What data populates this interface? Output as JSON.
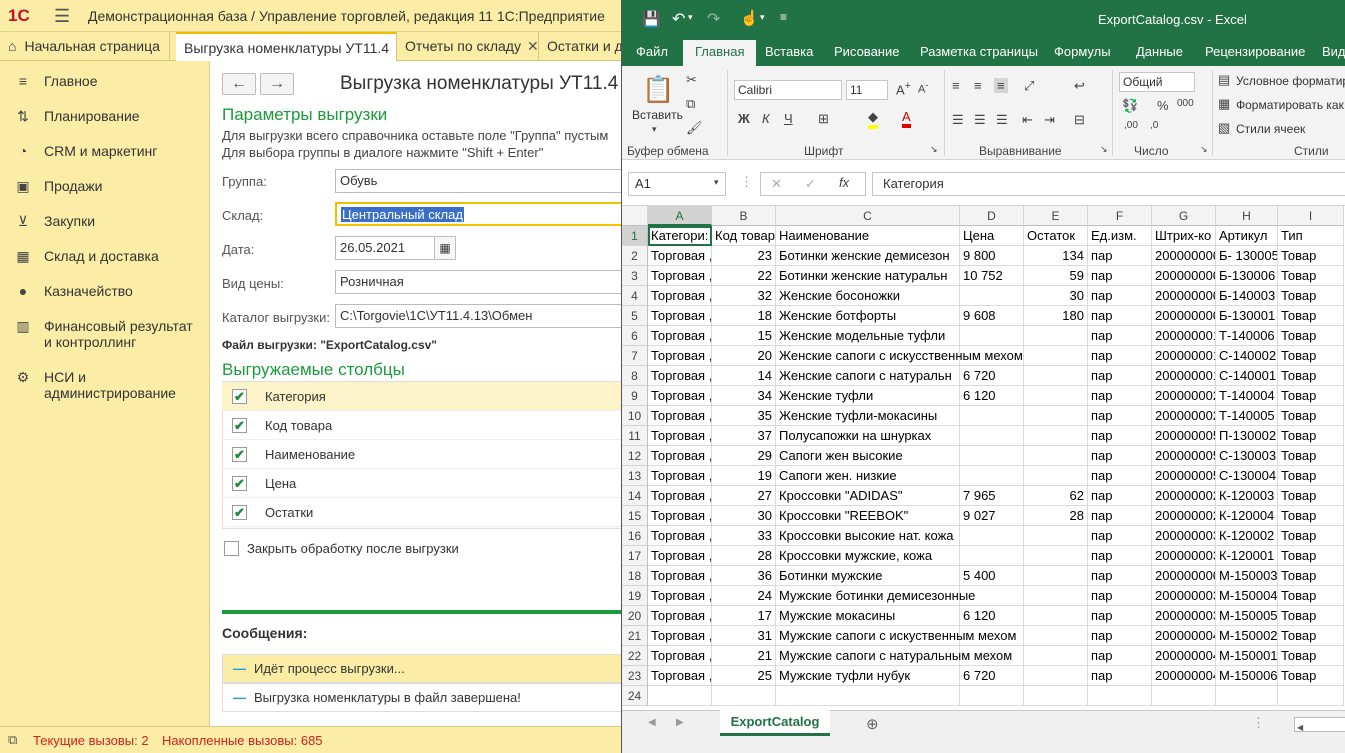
{
  "onec": {
    "logo": "1С",
    "window_title": "Демонстрационная база / Управление торговлей, редакция 11 1С:Предприятие",
    "tabs": [
      {
        "label": "Начальная страница"
      },
      {
        "label": "Выгрузка номенклатуры УТ11.4"
      },
      {
        "label": "Отчеты по складу"
      },
      {
        "label": "Остатки и д"
      }
    ],
    "sidebar": [
      {
        "label": "Главное"
      },
      {
        "label": "Планирование"
      },
      {
        "label": "CRM и маркетинг"
      },
      {
        "label": "Продажи"
      },
      {
        "label": "Закупки"
      },
      {
        "label": "Склад и доставка"
      },
      {
        "label": "Казначейство"
      },
      {
        "label": "Финансовый результат и контроллинг"
      },
      {
        "label": "НСИ и администрирование"
      }
    ],
    "form": {
      "title": "Выгрузка номенклатуры УТ11.4",
      "params_header": "Параметры выгрузки",
      "hint1": "Для выгрузки всего справочника оставьте поле \"Группа\" пустым",
      "hint2": "Для выбора группы в диалоге нажмите \"Shift + Enter\"",
      "fields": [
        {
          "label": "Группа:",
          "value": "Обувь"
        },
        {
          "label": "Склад:",
          "value": "Центральный склад"
        },
        {
          "label": "Дата:",
          "value": "26.05.2021"
        },
        {
          "label": "Вид цены:",
          "value": "Розничная"
        },
        {
          "label": "Каталог выгрузки:",
          "value": "C:\\Torgovie\\1C\\УТ11.4.13\\Обмен"
        }
      ],
      "file_label": "Файл выгрузки: \"ExportCatalog.csv\"",
      "columns_header": "Выгружаемые столбцы",
      "columns": [
        {
          "label": "Категория"
        },
        {
          "label": "Код товара"
        },
        {
          "label": "Наименование"
        },
        {
          "label": "Цена"
        },
        {
          "label": "Остатки"
        }
      ],
      "close_after": "Закрыть обработку после выгрузки",
      "messages_header": "Сообщения:",
      "messages": [
        {
          "text": "Идёт процесс выгрузки..."
        },
        {
          "text": "Выгрузка номенклатуры в файл завершена!"
        }
      ]
    },
    "status": {
      "current_calls": "Текущие вызовы: 2",
      "accumulated_calls": "Накопленные вызовы: 685"
    }
  },
  "excel": {
    "title": "ExportCatalog.csv - Excel",
    "ribbon_tabs": [
      "Файл",
      "Главная",
      "Вставка",
      "Рисование",
      "Разметка страницы",
      "Формулы",
      "Данные",
      "Рецензирование",
      "Вид"
    ],
    "paste_label": "Вставить",
    "font_name": "Calibri",
    "font_size": "11",
    "number_format": "Общий",
    "groups": {
      "clipboard": "Буфер обмена",
      "font": "Шрифт",
      "alignment": "Выравнивание",
      "number": "Число",
      "styles": "Стили"
    },
    "styles_items": [
      "Условное форматир",
      "Форматировать как",
      "Стили ячеек"
    ],
    "font_buttons": {
      "bold": "Ж",
      "italic": "К",
      "underline": "Ч"
    },
    "name_box": "A1",
    "formula_value": "Категория",
    "column_letters": [
      "A",
      "B",
      "C",
      "D",
      "E",
      "F",
      "G",
      "H",
      "I"
    ],
    "rows": [
      [
        "Категори:",
        "Код товар",
        "Наименование",
        "Цена",
        "Остаток",
        "Ед.изм.",
        "Штрих-ко",
        "Артикул",
        "Тип"
      ],
      [
        "Торговая ,",
        "23",
        "Ботинки женские демисезон",
        "9 800",
        "134",
        "пар",
        "200000000",
        "Б- 130005",
        "Товар"
      ],
      [
        "Торговая ,",
        "22",
        "Ботинки женские натуральн",
        "10 752",
        "59",
        "пар",
        "200000000",
        "Б-130006",
        "Товар"
      ],
      [
        "Торговая ,",
        "32",
        "Женские босоножки",
        "",
        "30",
        "пар",
        "200000000",
        "Б-140003",
        "Товар"
      ],
      [
        "Торговая ,",
        "18",
        "Женские ботфорты",
        "9 608",
        "180",
        "пар",
        "200000000",
        "Б-130001",
        "Товар"
      ],
      [
        "Торговая ,",
        "15",
        "Женские модельные туфли",
        "",
        "",
        "пар",
        "200000001",
        "Т-140006",
        "Товар"
      ],
      [
        "Торговая ,",
        "20",
        "Женские сапоги с искусственным мехом",
        "",
        "",
        "пар",
        "200000001",
        "С-140002",
        "Товар"
      ],
      [
        "Торговая ,",
        "14",
        "Женские сапоги с натуральн",
        "6 720",
        "",
        "пар",
        "200000001",
        "С-140001",
        "Товар"
      ],
      [
        "Торговая ,",
        "34",
        "Женские туфли",
        "6 120",
        "",
        "пар",
        "200000002",
        "Т-140004",
        "Товар"
      ],
      [
        "Торговая ,",
        "35",
        "Женские туфли-мокасины",
        "",
        "",
        "пар",
        "200000002",
        "Т-140005",
        "Товар"
      ],
      [
        "Торговая ,",
        "37",
        "Полусапожки на шнурках",
        "",
        "",
        "пар",
        "200000005",
        "П-130002",
        "Товар"
      ],
      [
        "Торговая ,",
        "29",
        "Сапоги жен высокие",
        "",
        "",
        "пар",
        "200000005",
        "С-130003",
        "Товар"
      ],
      [
        "Торговая ,",
        "19",
        "Сапоги жен. низкие",
        "",
        "",
        "пар",
        "200000005",
        "С-130004",
        "Товар"
      ],
      [
        "Торговая ,",
        "27",
        "Кроссовки \"ADIDAS\"",
        "7 965",
        "62",
        "пар",
        "200000002",
        "К-120003",
        "Товар"
      ],
      [
        "Торговая ,",
        "30",
        "Кроссовки \"REEBOK\"",
        "9 027",
        "28",
        "пар",
        "200000002",
        "К-120004",
        "Товар"
      ],
      [
        "Торговая ,",
        "33",
        "Кроссовки высокие нат. кожа",
        "",
        "",
        "пар",
        "200000003",
        "К-120002",
        "Товар"
      ],
      [
        "Торговая ,",
        "28",
        "Кроссовки мужские, кожа",
        "",
        "",
        "пар",
        "200000003",
        "К-120001",
        "Товар"
      ],
      [
        "Торговая ,",
        "36",
        "Ботинки мужские",
        "5 400",
        "",
        "пар",
        "200000000",
        "М-150003",
        "Товар"
      ],
      [
        "Торговая ,",
        "24",
        "Мужские ботинки демисезонные",
        "",
        "",
        "пар",
        "200000003",
        "М-150004",
        "Товар"
      ],
      [
        "Торговая ,",
        "17",
        "Мужские мокасины",
        "6 120",
        "",
        "пар",
        "200000003",
        "М-150005",
        "Товар"
      ],
      [
        "Торговая ,",
        "31",
        "Мужские сапоги с искуственным мехом",
        "",
        "",
        "пар",
        "200000004",
        "М-150002",
        "Товар"
      ],
      [
        "Торговая ,",
        "21",
        "Мужские сапоги с натуральным мехом",
        "",
        "",
        "пар",
        "200000004",
        "М-150001",
        "Товар"
      ],
      [
        "Торговая ,",
        "25",
        "Мужские туфли нубук",
        "6 720",
        "",
        "пар",
        "200000004",
        "М-150006",
        "Товар"
      ]
    ],
    "sheet_tab": "ExportCatalog",
    "colors": {
      "green": "#217346"
    }
  }
}
